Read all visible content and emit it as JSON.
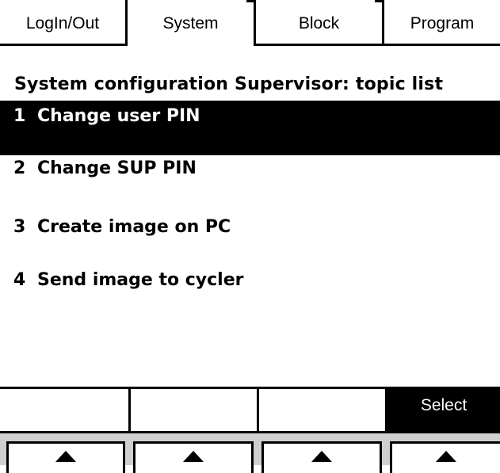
{
  "tabs": [
    {
      "label": "LogIn/Out"
    },
    {
      "label": "System"
    },
    {
      "label": "Block"
    },
    {
      "label": "Program"
    }
  ],
  "active_tab": "System",
  "page_title": "System configuration Supervisor: topic list",
  "topics": [
    {
      "num": "1",
      "label": "Change user PIN"
    },
    {
      "num": "2",
      "label": "Change SUP PIN"
    },
    {
      "num": "3",
      "label": "Create image on PC"
    },
    {
      "num": "4",
      "label": "Send image to cycler"
    }
  ],
  "selected_topic": "1",
  "softkeys": [
    {
      "label": ""
    },
    {
      "label": ""
    },
    {
      "label": ""
    },
    {
      "label": "Select"
    }
  ],
  "hardware_keys": [
    {
      "icon": "up-arrow-icon"
    },
    {
      "icon": "up-arrow-icon"
    },
    {
      "icon": "up-arrow-icon"
    },
    {
      "icon": "up-arrow-icon"
    }
  ]
}
